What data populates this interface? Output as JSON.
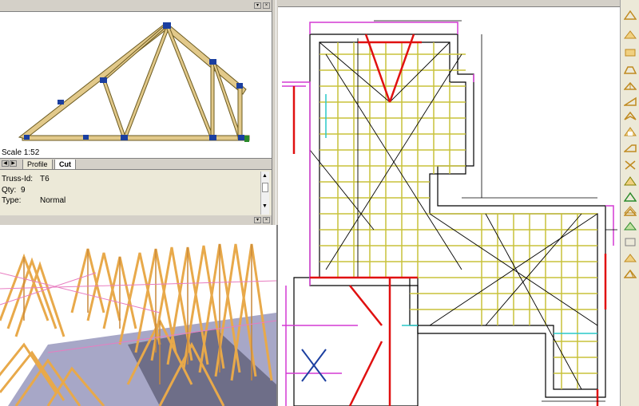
{
  "colors": {
    "truss_member": "#e2c98a",
    "truss_outline": "#6b5a20",
    "joint": "#1b3fa0",
    "plan_yellow": "#c9c23a",
    "plan_magenta": "#d33ad3",
    "plan_red": "#e01010",
    "plan_black": "#000000",
    "wood_3d": "#e8a94a",
    "pink_3d": "#e87cc0",
    "slab_3d": "#a7a7c7"
  },
  "truss_view": {
    "scale_label": "Scale 1:52",
    "tabs": [
      "Profile",
      "Cut"
    ],
    "active_tab": "Cut"
  },
  "properties": {
    "rows": [
      {
        "label": "Truss-Id:",
        "value": "T6"
      },
      {
        "label": "Qty:",
        "value": "9"
      },
      {
        "label": "Type:",
        "value": "Normal"
      }
    ]
  },
  "toolbar": {
    "icons": [
      "roof-truss-icon",
      "girder-truss-icon",
      "gable-truss-icon",
      "hip-truss-icon",
      "valley-truss-icon",
      "monopitch-truss-icon",
      "scissor-truss-icon",
      "attic-truss-icon",
      "stub-truss-icon",
      "bracing-icon",
      "roof-pitch-icon",
      "plate-icon",
      "truss-stack-icon",
      "truss-green-icon",
      "truss-outline-icon",
      "truss-plan-icon",
      "truss-3d-icon"
    ]
  }
}
